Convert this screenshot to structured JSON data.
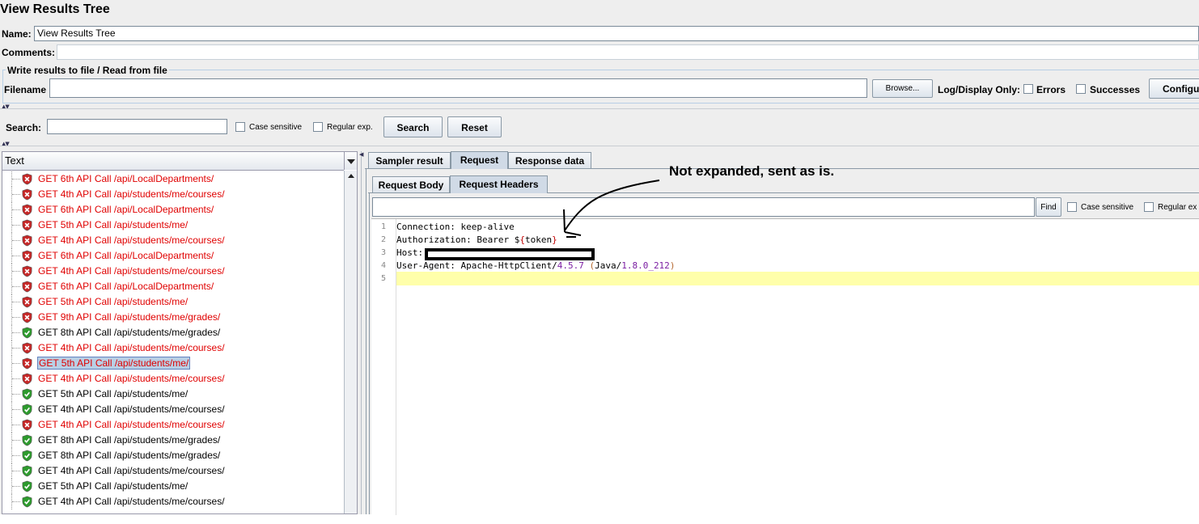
{
  "window": {
    "title": "View Results Tree"
  },
  "form": {
    "name_label": "Name:",
    "name_value": "View Results Tree",
    "comments_label": "Comments:"
  },
  "file_group": {
    "title": "Write results to file / Read from file",
    "filename_label": "Filename",
    "filename_value": "",
    "browse_label": "Browse...",
    "log_display_label": "Log/Display Only:",
    "errors_label": "Errors",
    "successes_label": "Successes",
    "configure_label": "Configu"
  },
  "search_bar": {
    "label": "Search:",
    "value": "",
    "case_sensitive_label": "Case sensitive",
    "regex_label": "Regular exp.",
    "search_button": "Search",
    "reset_button": "Reset"
  },
  "tree": {
    "header": "Text",
    "selected_index": 12,
    "items": [
      {
        "text": "GET 6th API Call /api/LocalDepartments/",
        "status": "error"
      },
      {
        "text": "GET 4th API Call /api/students/me/courses/",
        "status": "error"
      },
      {
        "text": "GET 6th API Call /api/LocalDepartments/",
        "status": "error"
      },
      {
        "text": "GET 5th API Call /api/students/me/",
        "status": "error"
      },
      {
        "text": "GET 4th API Call /api/students/me/courses/",
        "status": "error"
      },
      {
        "text": "GET 6th API Call /api/LocalDepartments/",
        "status": "error"
      },
      {
        "text": "GET 4th API Call /api/students/me/courses/",
        "status": "error"
      },
      {
        "text": "GET 6th API Call /api/LocalDepartments/",
        "status": "error"
      },
      {
        "text": "GET 5th API Call /api/students/me/",
        "status": "error"
      },
      {
        "text": "GET 9th API Call /api/students/me/grades/",
        "status": "error"
      },
      {
        "text": "GET 8th API Call /api/students/me/grades/",
        "status": "success"
      },
      {
        "text": "GET 4th API Call /api/students/me/courses/",
        "status": "error"
      },
      {
        "text": "GET 5th API Call /api/students/me/",
        "status": "error"
      },
      {
        "text": "GET 4th API Call /api/students/me/courses/",
        "status": "error"
      },
      {
        "text": "GET 5th API Call /api/students/me/",
        "status": "success"
      },
      {
        "text": "GET 4th API Call /api/students/me/courses/",
        "status": "success"
      },
      {
        "text": "GET 4th API Call /api/students/me/courses/",
        "status": "error"
      },
      {
        "text": "GET 8th API Call /api/students/me/grades/",
        "status": "success"
      },
      {
        "text": "GET 8th API Call /api/students/me/grades/",
        "status": "success"
      },
      {
        "text": "GET 4th API Call /api/students/me/courses/",
        "status": "success"
      },
      {
        "text": "GET 5th API Call /api/students/me/",
        "status": "success"
      },
      {
        "text": "GET 4th API Call /api/students/me/courses/",
        "status": "success"
      }
    ]
  },
  "tabs": {
    "main": [
      "Sampler result",
      "Request",
      "Response data"
    ],
    "main_active": "Request",
    "sub": [
      "Request Body",
      "Request Headers"
    ],
    "sub_active": "Request Headers"
  },
  "find_bar": {
    "value": "",
    "find_button": "Find",
    "case_sensitive_label": "Case sensitive",
    "regex_label": "Regular ex"
  },
  "headers_editor": {
    "line_numbers": [
      "1",
      "2",
      "3",
      "4",
      "5"
    ],
    "line1": {
      "key": "Connection:",
      "value": " keep-alive"
    },
    "line2": {
      "key": "Authorization:",
      "value": " Bearer $",
      "brace_open": "{",
      "var": "token",
      "brace_close": "}"
    },
    "line3": {
      "key": "Host:"
    },
    "line4": {
      "key": "User-Agent:",
      "value": " Apache-HttpClient",
      "sep1": "/",
      "ver1": "4.5.7",
      "paren_open": " (",
      "java": "Java",
      "sep2": "/",
      "ver2": "1.8.0_212",
      "paren_close": ")"
    }
  },
  "annotation": {
    "text": "Not expanded, sent as is."
  },
  "colors": {
    "error_text": "#e00000",
    "success_shield": "#2e9b2e",
    "error_shield": "#c62828",
    "current_line": "#ffffaa"
  }
}
